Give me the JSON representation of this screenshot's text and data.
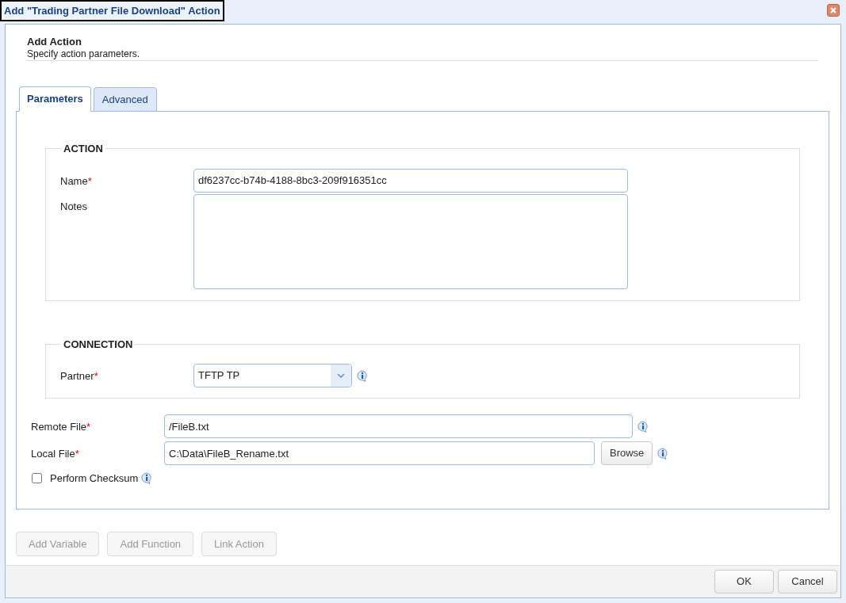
{
  "window": {
    "title": "Add \"Trading Partner File Download\" Action"
  },
  "header": {
    "title": "Add Action",
    "subtitle": "Specify action parameters."
  },
  "tabs": [
    {
      "label": "Parameters",
      "selected": true
    },
    {
      "label": "Advanced",
      "selected": false
    }
  ],
  "sections": [
    {
      "legend": "ACTION",
      "fields": [
        {
          "kind": "text",
          "label": "Name",
          "required_mark": "*",
          "value": "df6237cc-b74b-4188-8bc3-209f916351cc",
          "info": false
        },
        {
          "kind": "textarea",
          "label": "Notes",
          "info": false
        }
      ]
    },
    {
      "legend": "CONNECTION",
      "fields": [
        {
          "kind": "select",
          "label": "Partner",
          "required_mark": "*",
          "value": "TFTP TP",
          "info": true
        }
      ]
    }
  ],
  "fields": [
    {
      "kind": "text",
      "label": "Remote File",
      "required_mark": "*",
      "value": "/FileB.txt",
      "info": true
    },
    {
      "kind": "file",
      "label": "Local File",
      "required_mark": "*",
      "value": "C:\\Data\\FileB_Rename.txt",
      "button": "Browse",
      "info": true
    },
    {
      "kind": "checkbox",
      "label": "Perform Checksum",
      "checked": false,
      "info": true
    }
  ],
  "action_buttons": [
    {
      "label": "Add Variable",
      "disabled": true
    },
    {
      "label": "Add Function",
      "disabled": true
    },
    {
      "label": "Link Action",
      "disabled": true
    }
  ],
  "dialog_buttons": [
    {
      "label": "OK"
    },
    {
      "label": "Cancel"
    }
  ]
}
